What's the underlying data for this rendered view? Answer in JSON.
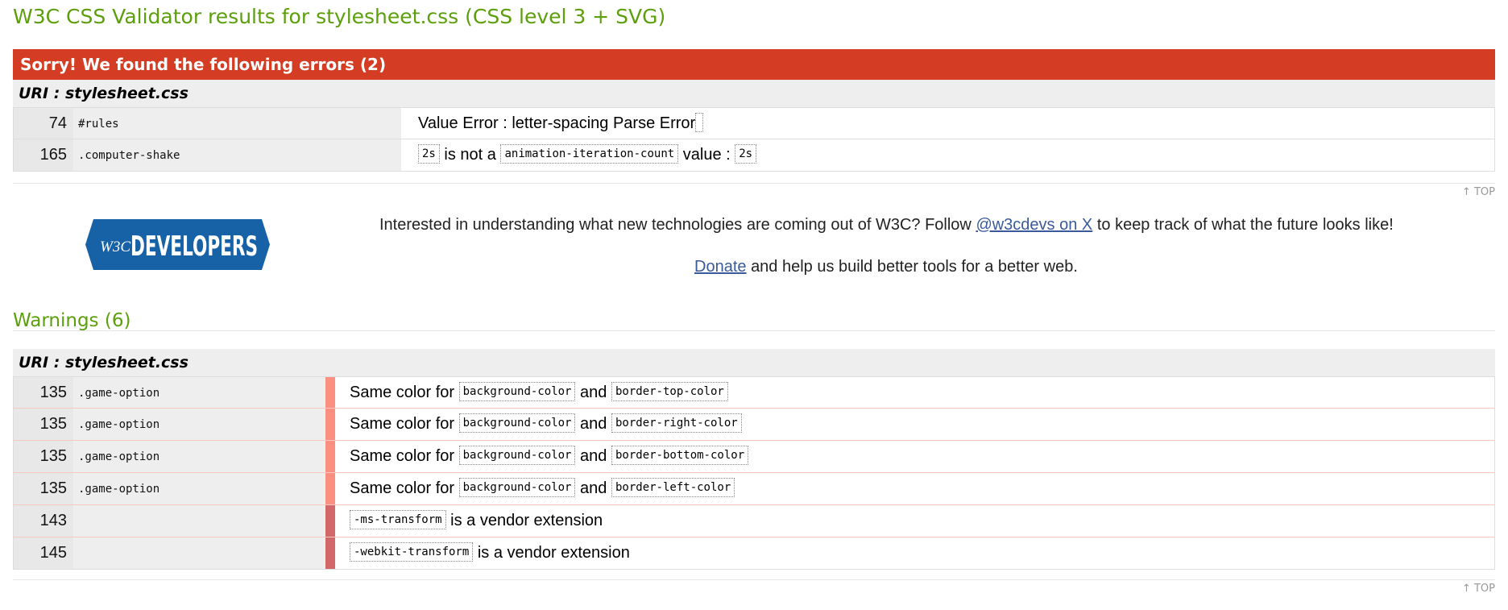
{
  "page": {
    "title": "W3C CSS Validator results for stylesheet.css (CSS level 3 + SVG)"
  },
  "errors": {
    "header": "Sorry! We found the following errors (2)",
    "uri": "URI : stylesheet.css",
    "rows": [
      {
        "line": "74",
        "context": "#rules",
        "msg_text": "Value Error : letter-spacing Parse Error"
      },
      {
        "line": "165",
        "context": ".computer-shake",
        "msg_value": "2s",
        "msg_mid": "is not a",
        "msg_prop": "animation-iteration-count",
        "msg_tail": "value :",
        "msg_value2": "2s"
      }
    ]
  },
  "top_link": "↑ TOP",
  "promo": {
    "logo_prefix": "W3C",
    "logo_text": "DEVELOPERS",
    "line1_pre": "Interested in understanding what new technologies are coming out of W3C? Follow",
    "line1_link": "@w3cdevs on X",
    "line1_post": "to keep track of what the future looks like!",
    "line2_link": "Donate",
    "line2_post": "and help us build better tools for a better web."
  },
  "warnings": {
    "title": "Warnings (6)",
    "uri": "URI : stylesheet.css",
    "rows": [
      {
        "line": "135",
        "context": ".game-option",
        "pre": "Same color for",
        "prop1": "background-color",
        "mid": "and",
        "prop2": "border-top-color",
        "level": 1
      },
      {
        "line": "135",
        "context": ".game-option",
        "pre": "Same color for",
        "prop1": "background-color",
        "mid": "and",
        "prop2": "border-right-color",
        "level": 1
      },
      {
        "line": "135",
        "context": ".game-option",
        "pre": "Same color for",
        "prop1": "background-color",
        "mid": "and",
        "prop2": "border-bottom-color",
        "level": 1
      },
      {
        "line": "135",
        "context": ".game-option",
        "pre": "Same color for",
        "prop1": "background-color",
        "mid": "and",
        "prop2": "border-left-color",
        "level": 1
      },
      {
        "line": "143",
        "context": "",
        "prop1": "-ms-transform",
        "post": "is a vendor extension",
        "level": 2
      },
      {
        "line": "145",
        "context": "",
        "prop1": "-webkit-transform",
        "post": "is a vendor extension",
        "level": 2
      }
    ]
  },
  "colors": {
    "title_green": "#5c9f0c",
    "error_red": "#d43d24",
    "warn_level1": "#fb9081",
    "warn_level2": "#d16869",
    "logo_blue": "#1762a6"
  }
}
